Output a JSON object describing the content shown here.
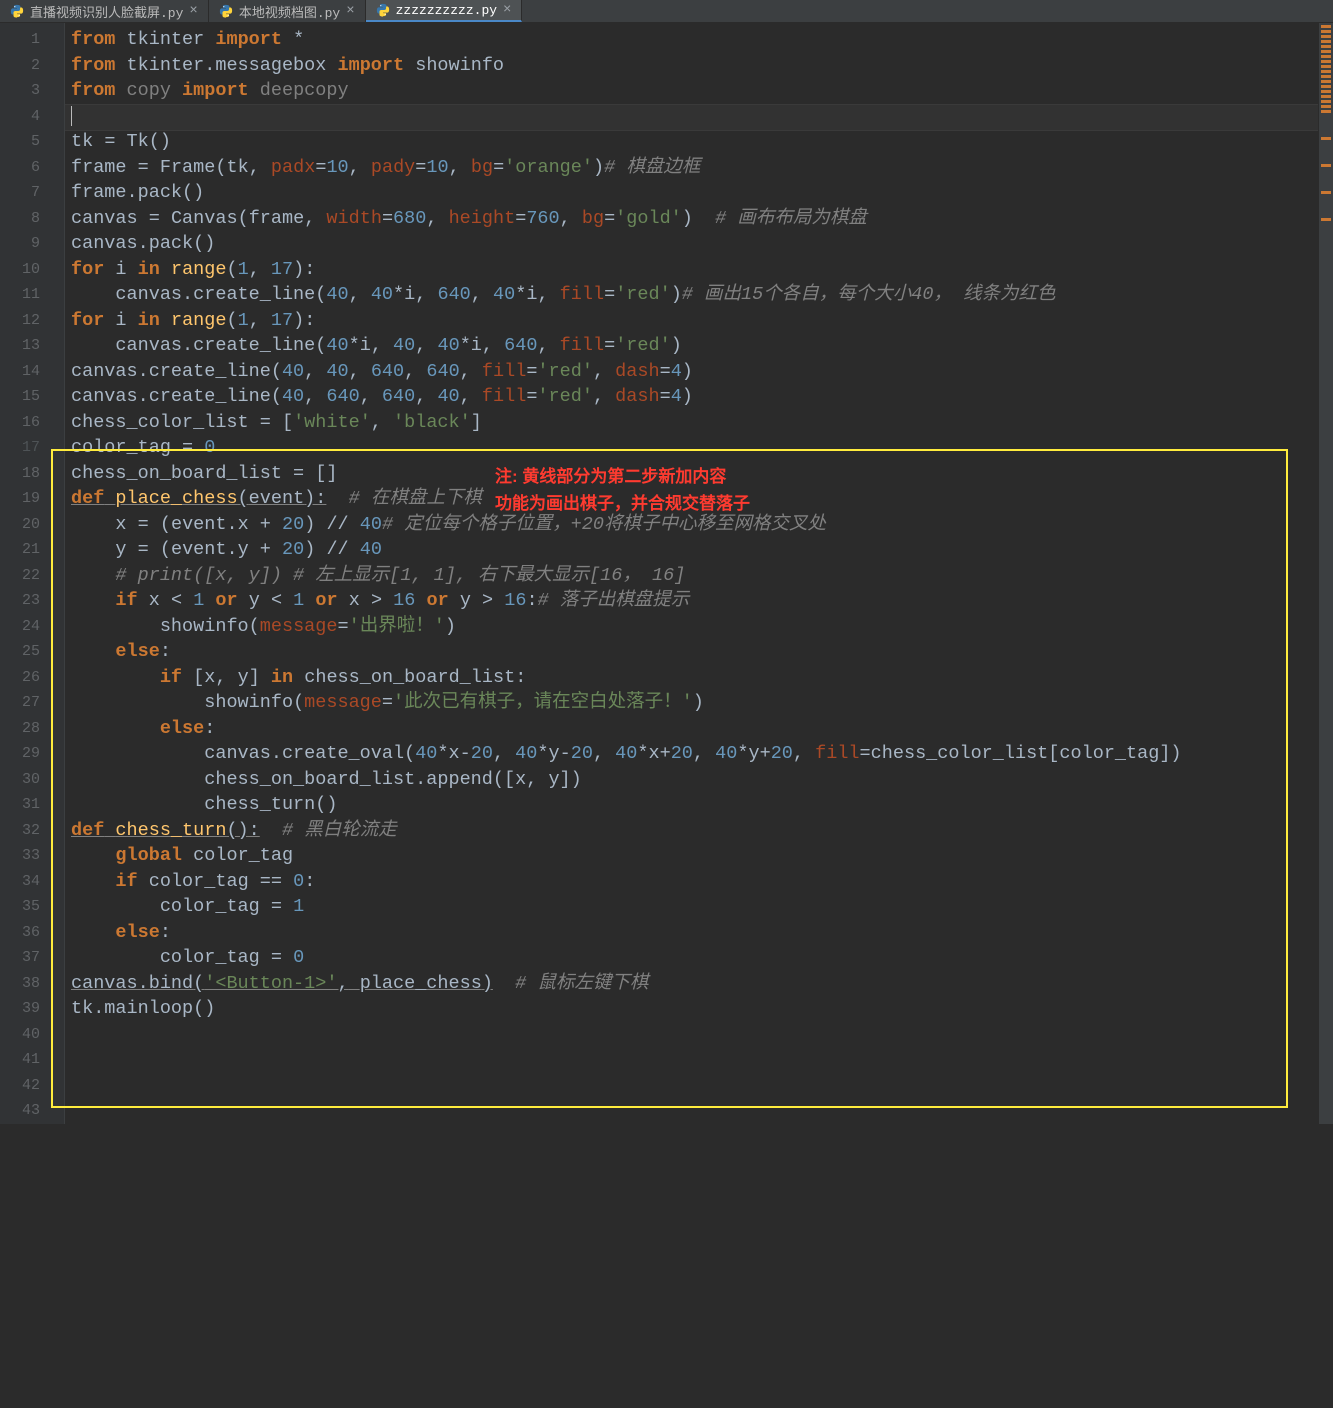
{
  "tabs": [
    {
      "label": "直播视频识别人脸截屏.py",
      "active": false
    },
    {
      "label": "本地视频档图.py",
      "active": false
    },
    {
      "label": "zzzzzzzzzz.py",
      "active": true
    }
  ],
  "annotation": {
    "line1": "注: 黄线部分为第二步新加内容",
    "line2": "功能为画出棋子，并合规交替落子"
  },
  "highlight": {
    "top_line": 18,
    "bottom_line": 42
  },
  "current_line": 4,
  "lines": [
    {
      "n": 1,
      "html": "<span class='kw'>from</span> <span class='name'>tkinter</span> <span class='kw'>import</span> <span class='op'>*</span>"
    },
    {
      "n": 2,
      "html": "<span class='kw'>from</span> <span class='name'>tkinter.messagebox</span> <span class='kw'>import</span> <span class='name'>showinfo</span>"
    },
    {
      "n": 3,
      "html": "<span class='squig'><span class='kw'>from</span> copy <span class='kw'>import</span> deepcopy</span>"
    },
    {
      "n": 4,
      "html": "<span class='caret'></span>"
    },
    {
      "n": 5,
      "html": "<span class='name'>tk</span> <span class='op'>=</span> <span class='name'>Tk</span><span class='op'>()</span>"
    },
    {
      "n": 6,
      "html": "<span class='name'>frame</span> <span class='op'>=</span> <span class='name'>Frame</span><span class='op'>(</span><span class='name'>tk</span><span class='op'>,</span> <span class='argp'>padx</span><span class='squig'>␣</span><span class='op'>=</span><span class='squig'>␣</span><span class='num'>10</span><span class='op'>,</span> <span class='argp'>pady</span><span class='squig'>␣</span><span class='op'>=</span><span class='squig'>␣</span><span class='num'>10</span><span class='op'>,</span> <span class='argp'>bg</span><span class='squig'>␣</span><span class='op'>=</span><span class='squig'>␣</span><span class='str'>'orange'</span><span class='op'>)</span><span class='squig'>␣</span><span class='cmt'># 棋盘边框</span>"
    },
    {
      "n": 7,
      "html": "<span class='name'>frame.pack</span><span class='op'>()</span>"
    },
    {
      "n": 8,
      "html": "<span class='name'>canvas</span> <span class='op'>=</span> <span class='name'>Canvas</span><span class='op'>(</span><span class='name'>frame</span><span class='op'>,</span> <span class='argp'>width</span><span class='squig'>␣</span><span class='op'>=</span><span class='squig'>␣</span><span class='num'>680</span><span class='op'>,</span> <span class='argp'>height</span><span class='squig'>␣</span><span class='op'>=</span><span class='squig'>␣</span><span class='num'>760</span><span class='op'>,</span> <span class='argp'>bg</span><span class='squig'>␣</span><span class='op'>=</span><span class='squig'>␣</span><span class='str'>'gold'</span><span class='op'>)</span>  <span class='cmt'># 画布布局为棋盘</span>"
    },
    {
      "n": 9,
      "html": "<span class='name'>canvas.pack</span><span class='op'>()</span>"
    },
    {
      "n": 10,
      "html": ""
    },
    {
      "n": 11,
      "html": "<span class='kw'>for</span> <span class='name'>i</span> <span class='kw'>in</span> <span class='fn'>range</span><span class='op'>(</span><span class='num'>1</span><span class='op'>,</span> <span class='num'>17</span><span class='op'>):</span>"
    },
    {
      "n": 12,
      "html": "    <span class='name'>canvas.create_line</span><span class='op'>(</span><span class='num'>40</span><span class='op'>,</span> <span class='num'>40</span><span class='op'>*</span><span class='name'>i</span><span class='op'>,</span> <span class='num'>640</span><span class='op'>,</span> <span class='num'>40</span><span class='op'>*</span><span class='name'>i</span><span class='op'>,</span> <span class='argp'>fill</span><span class='squig'>␣</span><span class='op'>=</span><span class='squig'>␣</span><span class='str'>'red'</span><span class='op'>)</span><span class='squig'>␣</span><span class='cmt'># 画出15个各自，每个大小40， 线条为红色</span>"
    },
    {
      "n": 13,
      "html": "<span class='kw'>for</span> <span class='name'>i</span> <span class='kw'>in</span> <span class='fn'>range</span><span class='op'>(</span><span class='num'>1</span><span class='op'>,</span> <span class='num'>17</span><span class='op'>):</span>"
    },
    {
      "n": 14,
      "html": "    <span class='name'>canvas.create_line</span><span class='op'>(</span><span class='num'>40</span><span class='op'>*</span><span class='name'>i</span><span class='op'>,</span> <span class='num'>40</span><span class='op'>,</span> <span class='num'>40</span><span class='op'>*</span><span class='name'>i</span><span class='op'>,</span> <span class='num'>640</span><span class='op'>,</span> <span class='argp'>fill</span><span class='squig'>␣</span><span class='op'>=</span><span class='squig'>␣</span><span class='str'>'red'</span><span class='op'>)</span>"
    },
    {
      "n": 15,
      "html": "<span class='name'>canvas.create_line</span><span class='op'>(</span><span class='num'>40</span><span class='op'>,</span> <span class='num'>40</span><span class='op'>,</span> <span class='num'>640</span><span class='op'>,</span> <span class='num'>640</span><span class='op'>,</span> <span class='argp'>fill</span><span class='squig'>␣</span><span class='op'>=</span><span class='squig'>␣</span><span class='str'>'red'</span><span class='op'>,</span> <span class='argp'>dash</span><span class='squig'>␣</span><span class='op'>=</span><span class='squig'>␣</span><span class='num'>4</span><span class='op'>)</span>"
    },
    {
      "n": 16,
      "html": "<span class='name'>canvas.create_line</span><span class='op'>(</span><span class='num'>40</span><span class='op'>,</span> <span class='num'>640</span><span class='op'>,</span> <span class='num'>640</span><span class='op'>,</span> <span class='num'>40</span><span class='op'>,</span> <span class='argp'>fill</span><span class='squig'>␣</span><span class='op'>=</span><span class='squig'>␣</span><span class='str'>'red'</span><span class='op'>,</span> <span class='argp'>dash</span><span class='squig'>␣</span><span class='op'>=</span><span class='squig'>␣</span><span class='num'>4</span><span class='op'>)</span>"
    },
    {
      "n": 17,
      "dim": true,
      "html": ""
    },
    {
      "n": 18,
      "html": "<span class='name'>chess_color_list</span> <span class='op'>=</span> <span class='op'>[</span><span class='str'>'white'</span><span class='op'>,</span> <span class='str'>'black'</span><span class='op'>]</span>"
    },
    {
      "n": 19,
      "html": "<span class='name'>color_tag</span> <span class='op'>=</span> <span class='num'>0</span>"
    },
    {
      "n": 20,
      "html": "<span class='name'>chess_on_board_list</span> <span class='op'>=</span> <span class='op'>[]</span>"
    },
    {
      "n": 21,
      "html": "<span class='def under'>def</span><span class='under'> </span><span class='fn under'>place_chess</span><span class='op under'>(</span><span class='name under'>event</span><span class='op under'>):</span>  <span class='cmt'># 在棋盘上下棋</span>"
    },
    {
      "n": 22,
      "html": "    <span class='name'>x</span> <span class='op'>=</span> <span class='op'>(</span><span class='name'>event.x</span> <span class='op'>+</span> <span class='num'>20</span><span class='op'>)</span> <span class='op'>//</span> <span class='num'>40</span><span class='squig'>␣</span><span class='cmt'># 定位每个格子位置，+20将棋子中心移至网格交叉处</span>"
    },
    {
      "n": 23,
      "html": "    <span class='name'>y</span> <span class='op'>=</span> <span class='op'>(</span><span class='name'>event.y</span> <span class='op'>+</span> <span class='num'>20</span><span class='op'>)</span> <span class='op'>//</span> <span class='num'>40</span>"
    },
    {
      "n": 24,
      "html": "    <span class='cmt'># print([x, y]) # 左上显示[1, 1], 右下最大显示[16， 16]</span>"
    },
    {
      "n": 25,
      "html": "    <span class='kw'>if</span> <span class='name'>x</span> <span class='op'>&lt;</span> <span class='num'>1</span> <span class='kw'>or</span> <span class='name'>y</span> <span class='op'>&lt;</span> <span class='num'>1</span> <span class='kw'>or</span> <span class='name'>x</span> <span class='op'>&gt;</span> <span class='num'>16</span> <span class='kw'>or</span> <span class='name'>y</span> <span class='op'>&gt;</span> <span class='num'>16</span><span class='op'>:</span><span class='squig'>␣</span><span class='cmt'># 落子出棋盘提示</span>"
    },
    {
      "n": 26,
      "html": "        <span class='name'>showinfo</span><span class='op'>(</span><span class='argp'>message</span><span class='op'>=</span><span class='str'>'出界啦！'</span><span class='op'>)</span>"
    },
    {
      "n": 27,
      "html": "    <span class='kw'>else</span><span class='op'>:</span>"
    },
    {
      "n": 28,
      "html": "        <span class='kw'>if</span> <span class='op'>[</span><span class='name'>x</span><span class='op'>,</span> <span class='name'>y</span><span class='op'>]</span> <span class='kw'>in</span> <span class='name'>chess_on_board_list</span><span class='op'>:</span>"
    },
    {
      "n": 29,
      "html": "            <span class='name'>showinfo</span><span class='op'>(</span><span class='argp'>message</span><span class='op'>=</span><span class='str'>'此次已有棋子，请在空白处落子！'</span><span class='op'>)</span>"
    },
    {
      "n": 30,
      "html": "        <span class='kw'>else</span><span class='op'>:</span>"
    },
    {
      "n": 31,
      "html": "            <span class='name'>canvas.create_oval</span><span class='op'>(</span><span class='num'>40</span><span class='op'>*</span><span class='name'>x</span><span class='op'>-</span><span class='num'>20</span><span class='op'>,</span> <span class='num'>40</span><span class='op'>*</span><span class='name'>y</span><span class='op'>-</span><span class='num'>20</span><span class='op'>,</span> <span class='num'>40</span><span class='op'>*</span><span class='name'>x</span><span class='op'>+</span><span class='num'>20</span><span class='op'>,</span> <span class='num'>40</span><span class='op'>*</span><span class='name'>y</span><span class='op'>+</span><span class='num'>20</span><span class='op'>,</span> <span class='argp'>fill</span><span class='op'>=</span><span class='name'>chess_color_list</span><span class='op'>[</span><span class='name'>color_tag</span><span class='op'>])</span>"
    },
    {
      "n": 32,
      "html": "            <span class='name'>chess_on_board_list.append</span><span class='op'>([</span><span class='name'>x</span><span class='op'>,</span> <span class='name'>y</span><span class='op'>])</span>"
    },
    {
      "n": 33,
      "html": "            <span class='name'>chess_turn</span><span class='op'>()</span>"
    },
    {
      "n": 34,
      "html": ""
    },
    {
      "n": 35,
      "html": "<span class='def under'>def</span><span class='under'> </span><span class='fn under'>chess_turn</span><span class='op under'>():</span>  <span class='cmt'># 黑白轮流走</span>"
    },
    {
      "n": 36,
      "html": "    <span class='kw'>global</span> <span class='name'>color_tag</span>"
    },
    {
      "n": 37,
      "html": "    <span class='kw'>if</span> <span class='name'>color_tag</span> <span class='op'>==</span> <span class='num'>0</span><span class='op'>:</span>"
    },
    {
      "n": 38,
      "html": "        <span class='name'>color_tag</span> <span class='op'>=</span> <span class='num'>1</span>"
    },
    {
      "n": 39,
      "html": "    <span class='kw'>else</span><span class='op'>:</span>"
    },
    {
      "n": 40,
      "html": "        <span class='name'>color_tag</span> <span class='op'>=</span> <span class='num'>0</span>"
    },
    {
      "n": 41,
      "html": ""
    },
    {
      "n": 42,
      "html": "<span class='name under'>canvas.bind</span><span class='op under'>(</span><span class='str under'>'&lt;Button-1&gt;'</span><span class='op under'>,</span><span class='under'> </span><span class='name under'>place_chess</span><span class='op under'>)</span>  <span class='cmt'># 鼠标左键下棋</span>"
    },
    {
      "n": 43,
      "html": "<span class='name'>tk.mainloop</span><span class='op'>()</span>"
    }
  ]
}
